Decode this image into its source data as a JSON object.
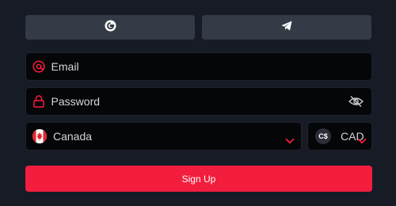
{
  "social": {
    "google_icon": "google-icon",
    "telegram_icon": "telegram-icon"
  },
  "form": {
    "email_placeholder": "Email",
    "password_placeholder": "Password",
    "country": "Canada",
    "currency_symbol": "C$",
    "currency": "CAD",
    "submit_label": "Sign Up"
  },
  "colors": {
    "accent": "#f31d3d",
    "background": "#161b26",
    "field_bg": "#050608",
    "social_bg": "#343a46"
  }
}
